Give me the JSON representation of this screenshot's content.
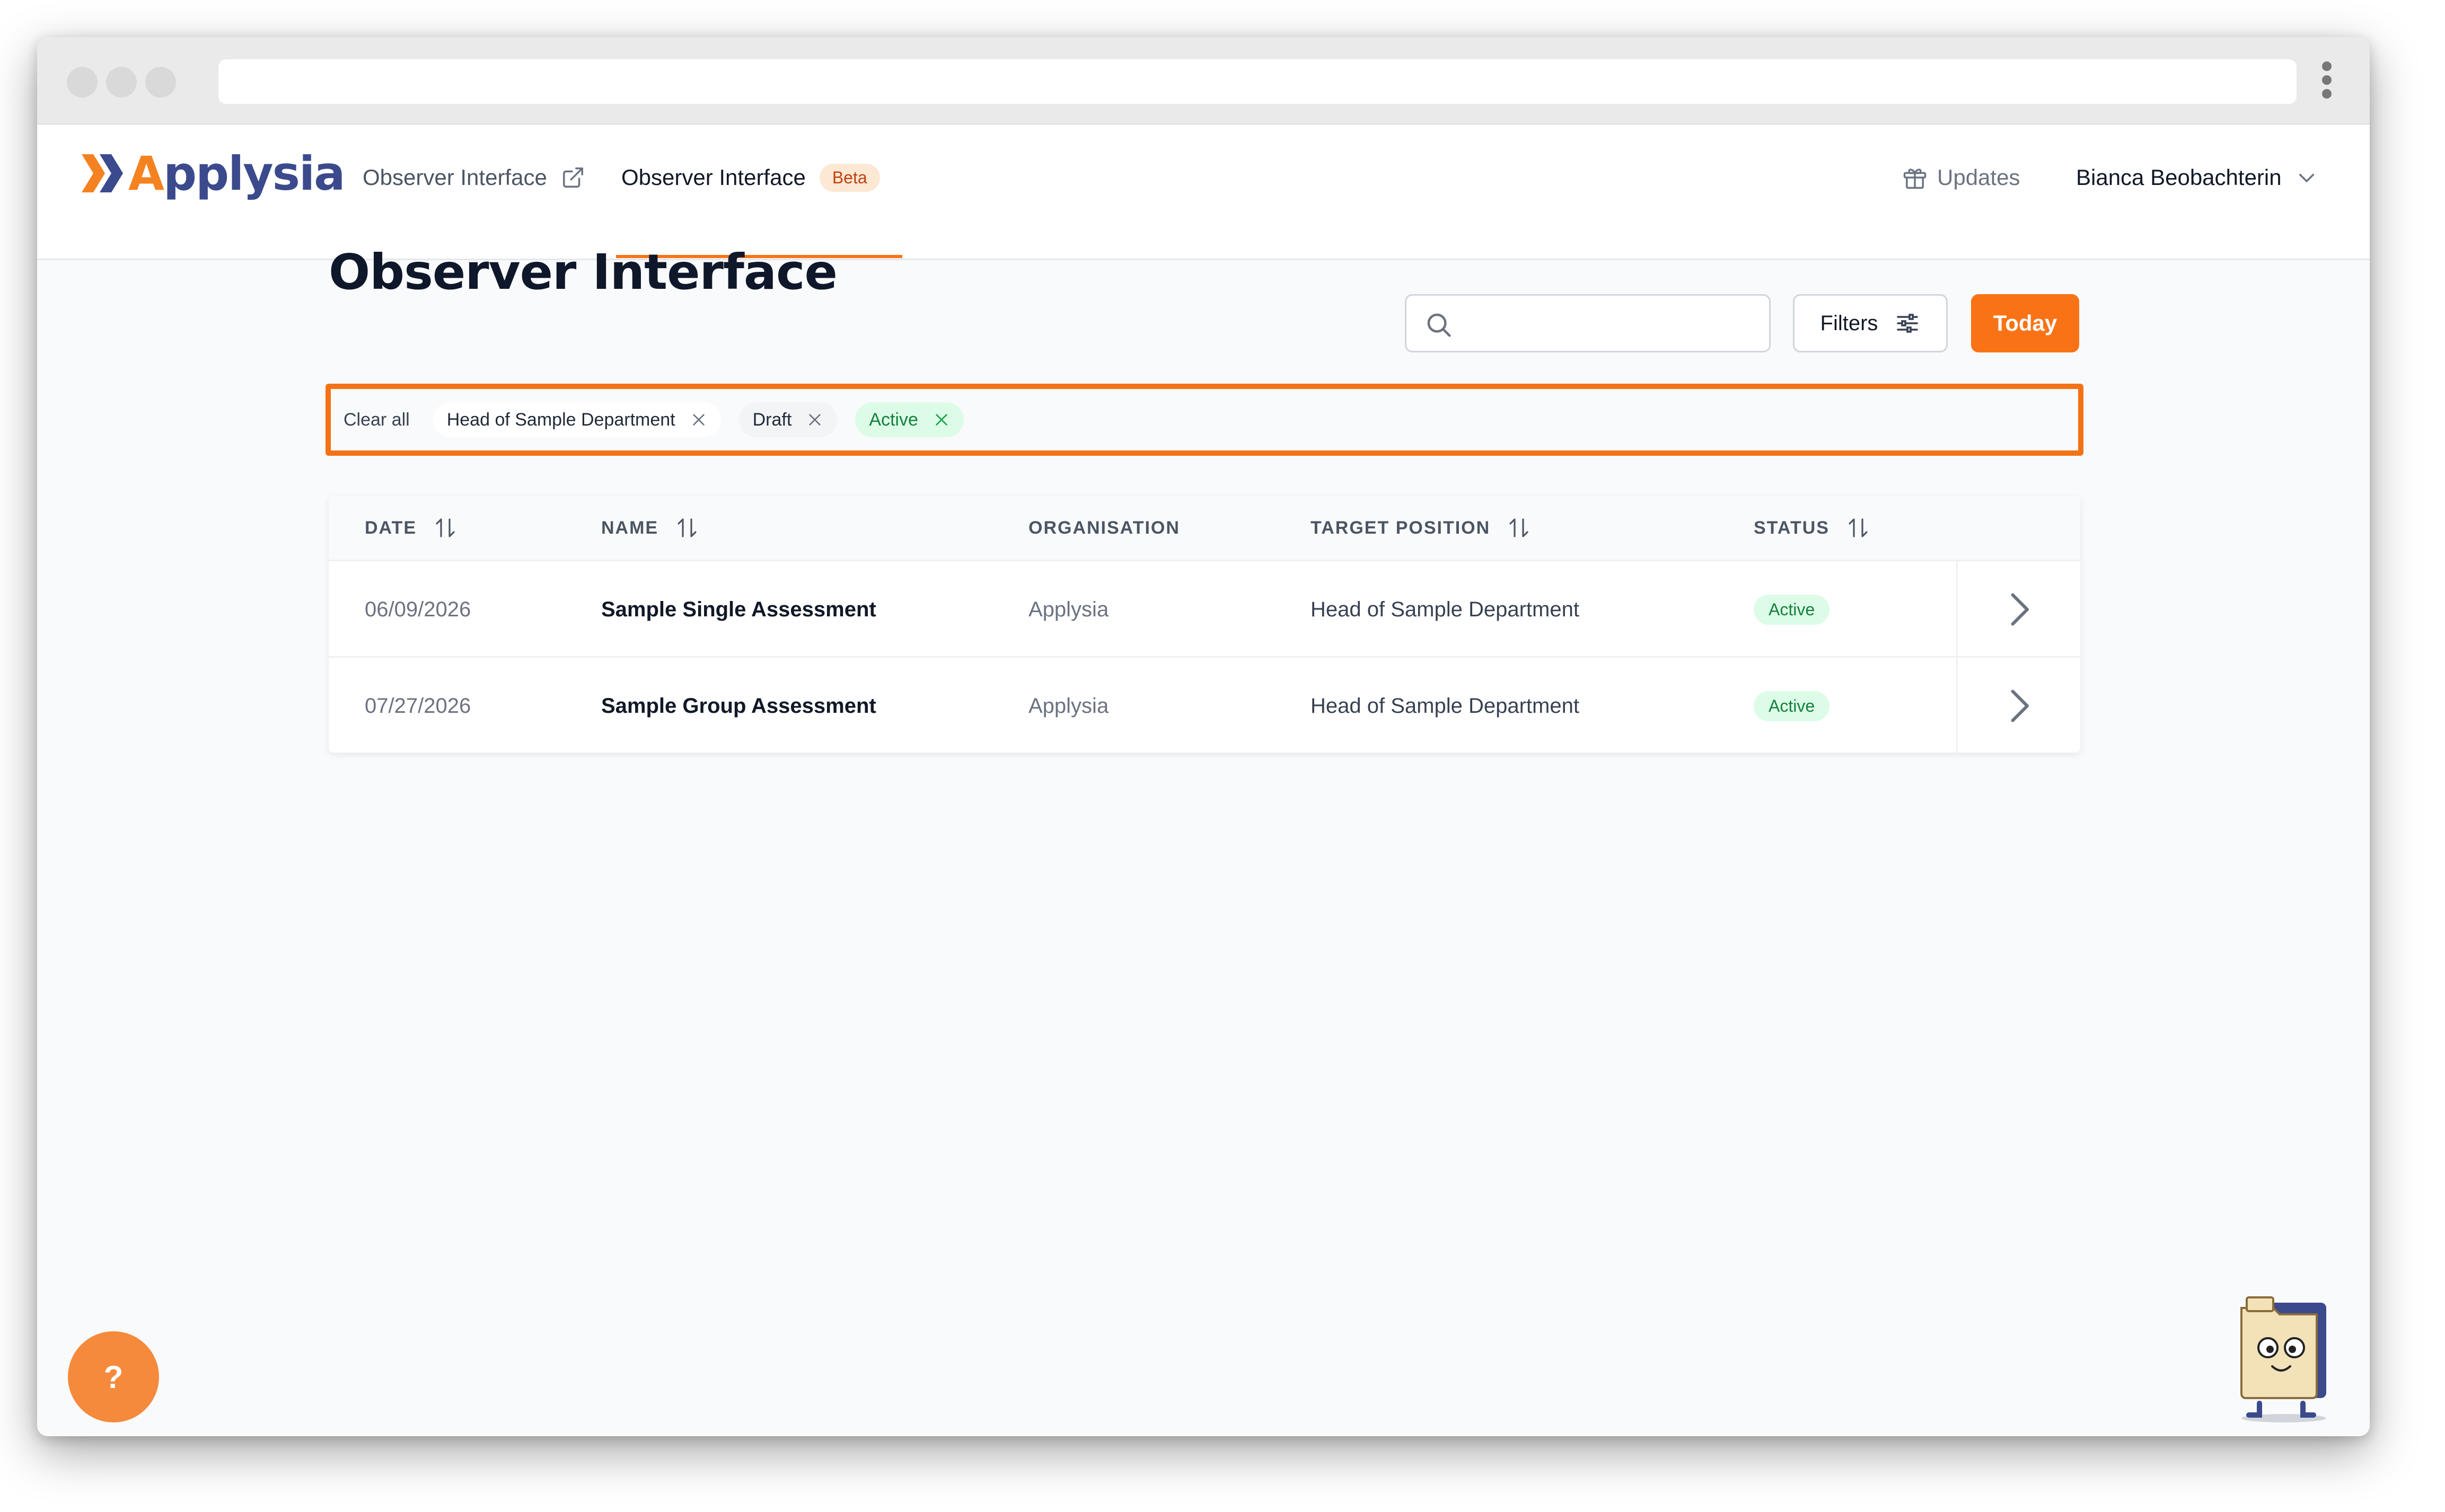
{
  "brand": {
    "logo_a": "A",
    "logo_rest": "pplysia",
    "accent": "#f97316",
    "navy": "#3b4a8c"
  },
  "nav": {
    "tabs": [
      {
        "label": "Observer Interface",
        "icon": "external-link-icon"
      },
      {
        "label": "Observer Interface",
        "badge": "Beta",
        "active": true
      }
    ],
    "updates_label": "Updates",
    "user_name": "Bianca Beobachterin"
  },
  "page": {
    "title": "Observer Interface",
    "search_placeholder": "",
    "filters_label": "Filters",
    "today_label": "Today"
  },
  "active_filters": {
    "clear_all": "Clear all",
    "chips": [
      "Head of Sample Department",
      "Draft",
      "Active"
    ]
  },
  "table": {
    "headers": {
      "date": "DATE",
      "name": "NAME",
      "organisation": "ORGANISATION",
      "target_position": "TARGET POSITION",
      "status": "STATUS"
    },
    "rows": [
      {
        "date": "06/09/2026",
        "name": "Sample Single Assessment",
        "organisation": "Applysia",
        "target_position": "Head of Sample Department",
        "status": "Active"
      },
      {
        "date": "07/27/2026",
        "name": "Sample Group Assessment",
        "organisation": "Applysia",
        "target_position": "Head of Sample Department",
        "status": "Active"
      }
    ]
  },
  "help": {
    "icon": "question-icon",
    "label": "?"
  },
  "status_colors": {
    "active_bg": "#dcfce7",
    "active_text": "#15803d"
  }
}
